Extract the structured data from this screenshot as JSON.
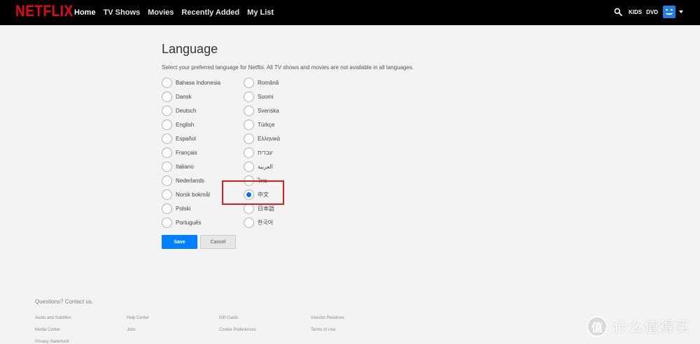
{
  "header": {
    "logo": "NETFLIX",
    "nav": [
      "Home",
      "TV Shows",
      "Movies",
      "Recently Added",
      "My List"
    ],
    "kids": "KIDS",
    "dvd": "DVD"
  },
  "main": {
    "title": "Language",
    "subtitle": "Select your preferred language for Netflix. All TV shows and movies are not available in all languages.",
    "languages_left": [
      "Bahasa Indonesia",
      "Dansk",
      "Deutsch",
      "English",
      "Español",
      "Français",
      "Italiano",
      "Nederlands",
      "Norsk bokmål",
      "Polski",
      "Português"
    ],
    "languages_right": [
      "Română",
      "Suomi",
      "Svenska",
      "Türkçe",
      "Ελληνικά",
      "עברית",
      "العربية",
      "ไทย",
      "中文",
      "日本語",
      "한국어"
    ],
    "selected": "中文",
    "save_label": "Save",
    "cancel_label": "Cancel"
  },
  "footer": {
    "contact": "Questions? Contact us.",
    "links": [
      "Audio and Subtitles",
      "Help Center",
      "Gift Cards",
      "Investor Relations",
      "Media Center",
      "Jobs",
      "Cookie Preferences",
      "Terms of Use",
      "Privacy Statement"
    ]
  },
  "watermark": {
    "glyph": "值",
    "text": "什么值得买"
  },
  "colors": {
    "brand_red": "#e50914",
    "accent_blue": "#0080ff",
    "highlight_red": "#d91e1e"
  }
}
